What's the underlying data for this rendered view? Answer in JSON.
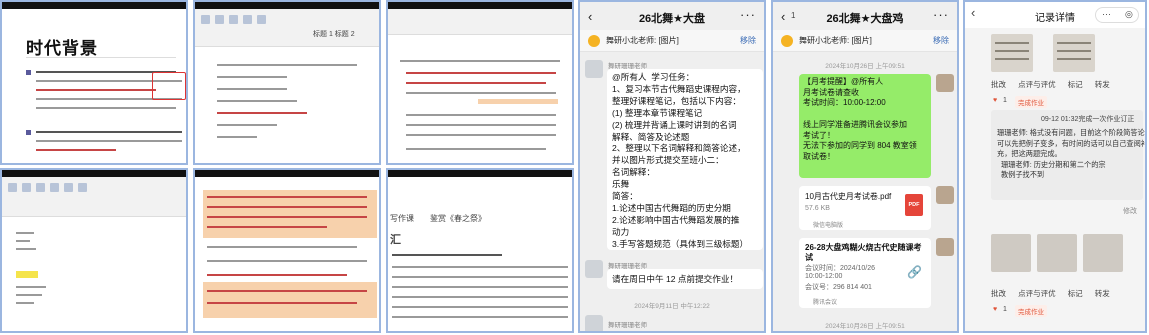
{
  "tile_a": {
    "title": "时代背景"
  },
  "tile_b": {
    "heading_snippet": "标题 1   标题 2"
  },
  "tile_e": {
    "heading_a": "写作课",
    "heading_b": "鉴赏《春之祭》",
    "heading_c": "汇"
  },
  "chat1": {
    "title": "26北舞★大盘",
    "pin_text": "舞研小北老师: [图片]",
    "pin_remove": "移除",
    "sender": "舞研珊珊老师",
    "message": "@所有人  学习任务：\n1、复习本节古代舞蹈史课程内容，\n整理好课程笔记，包括以下内容：\n(1) 整理本章节课程笔记\n(2) 梳理并背诵上课时讲到的名词\n解释、简答及论述题\n2、整理以下名词解释和简答论述，\n并以图片形式提交至班小二：\n名词解释：\n乐舞\n简答：\n1.论述中国古代舞蹈的历史分期\n2.论述影响中国古代舞蹈发展的推\n动力\n3.手写答题规范（具体到三级标题）",
    "sender2": "舞研珊珊老师",
    "message2": "请在周日中午 12 点前提交作业！",
    "time": "2024年9月11日 中午12:22",
    "sender3": "舞研珊珊老师"
  },
  "chat2": {
    "title": "26北舞★大盘鸡",
    "back_count": "1",
    "pin_text": "舞研小北老师: [图片]",
    "pin_remove": "移除",
    "time_top": "2024年10月26日 上午09:51",
    "notice": "【月考提醒】@所有人\n月考试卷请查收\n考试时间：10:00-12:00\n\n线上同学准备进腾讯会议参加\n考试了！\n无法下参加的同学到 804 教室领\n取试卷！",
    "file_name": "10月古代史月考试卷.pdf",
    "file_size": "57.6 KB",
    "file_src": "微信电脑版",
    "pdf_label": "PDF",
    "meeting_title": "26-28大盘鸡糊火烧古代史随课考\n试",
    "meeting_time": "会议时间：2024/10/26\n10:00-12:00",
    "meeting_id": "会议号：296 814 401",
    "meeting_src": "腾讯会议",
    "time_bottom": "2024年10月26日 上午09:51"
  },
  "record": {
    "title": "记录详情",
    "actions": [
      "批改",
      "点评与评优",
      "标记",
      "转发"
    ],
    "likes": "1",
    "status": "完成作业",
    "comment_time": "09-12 01:32完成一次作业订正",
    "comment": "珊珊老师: 格式没有问题，目前这个阶段简答论述\n可以先把例子变多，有时间的话可以自己查阅补\n充，把这两题完成。\n  珊珊老师: 历史分期和第二个的宗\n  教例子找不到",
    "edit": "修改",
    "actions2": [
      "批改",
      "点评与评优",
      "标记",
      "转发"
    ],
    "likes2": "1",
    "status2": "完成作业"
  }
}
